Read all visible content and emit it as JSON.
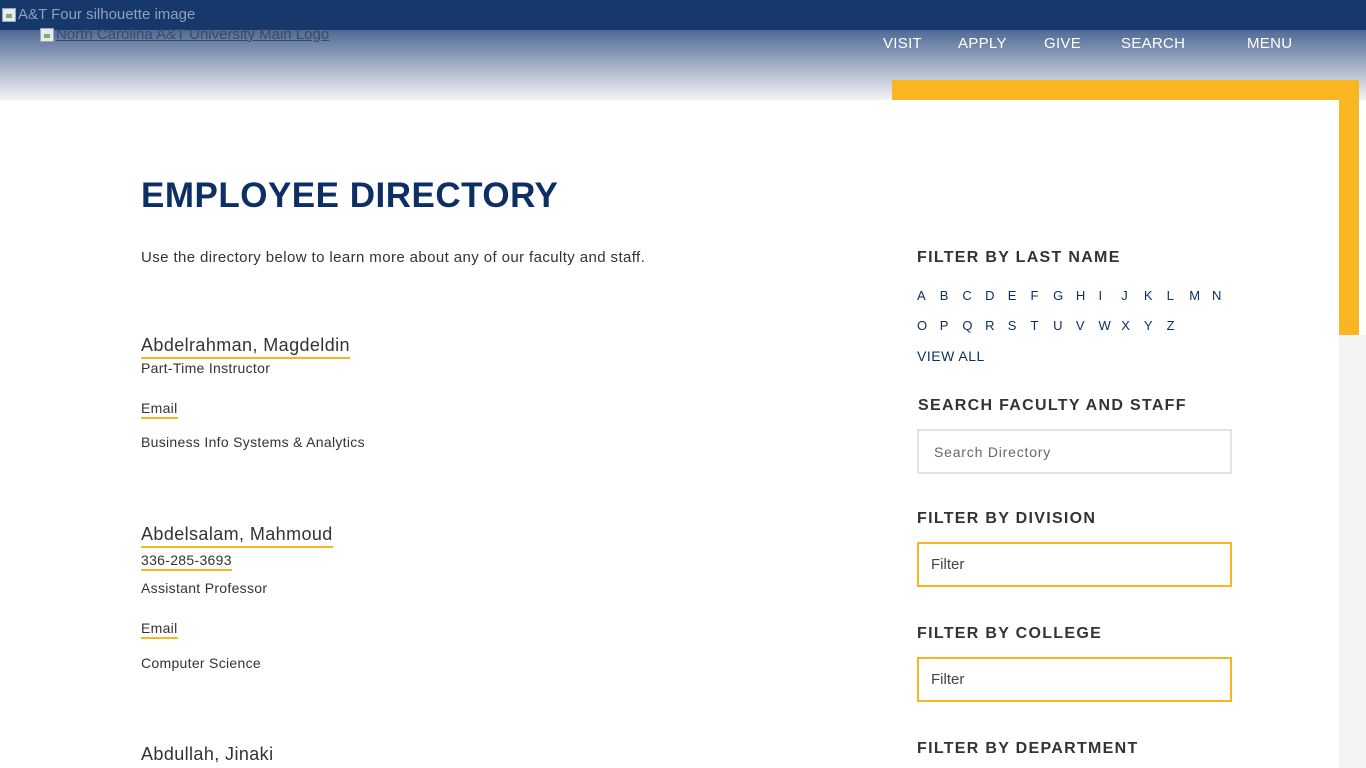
{
  "header": {
    "silhouette_alt": "A&T Four silhouette image",
    "logo_alt": "North Carolina A&T University Main Logo",
    "nav": [
      "VISIT",
      "APPLY",
      "GIVE",
      "SEARCH",
      "MENU"
    ]
  },
  "colors": {
    "navy": "#0e2f66",
    "gold": "#f9b522",
    "topbar": "#17386b"
  },
  "main": {
    "title": "EMPLOYEE DIRECTORY",
    "intro": "Use the directory below to learn more about any of our faculty and staff.",
    "employees": [
      {
        "name": "Abdelrahman, Magdeldin",
        "title": "Part-Time Instructor",
        "email_label": "Email",
        "department": "Business Info Systems & Analytics"
      },
      {
        "name": "Abdelsalam, Mahmoud",
        "phone": "336-285-3693",
        "title": "Assistant Professor",
        "email_label": "Email",
        "department": "Computer Science"
      },
      {
        "name": "Abdullah, Jinaki"
      }
    ]
  },
  "sidebar": {
    "last_name_heading": "FILTER BY LAST NAME",
    "letters_row1": [
      "A",
      "B",
      "C",
      "D",
      "E",
      "F",
      "G",
      "H",
      "I",
      "J",
      "K",
      "L",
      "M",
      "N"
    ],
    "letters_row2": [
      "O",
      "P",
      "Q",
      "R",
      "S",
      "T",
      "U",
      "V",
      "W",
      "X",
      "Y",
      "Z"
    ],
    "view_all": "VIEW ALL",
    "search_heading": "SEARCH FACULTY AND STAFF",
    "search_placeholder": "Search Directory",
    "division_heading": "FILTER BY DIVISION",
    "division_value": "Filter",
    "college_heading": "FILTER BY COLLEGE",
    "college_value": "Filter",
    "department_heading": "FILTER BY DEPARTMENT"
  }
}
